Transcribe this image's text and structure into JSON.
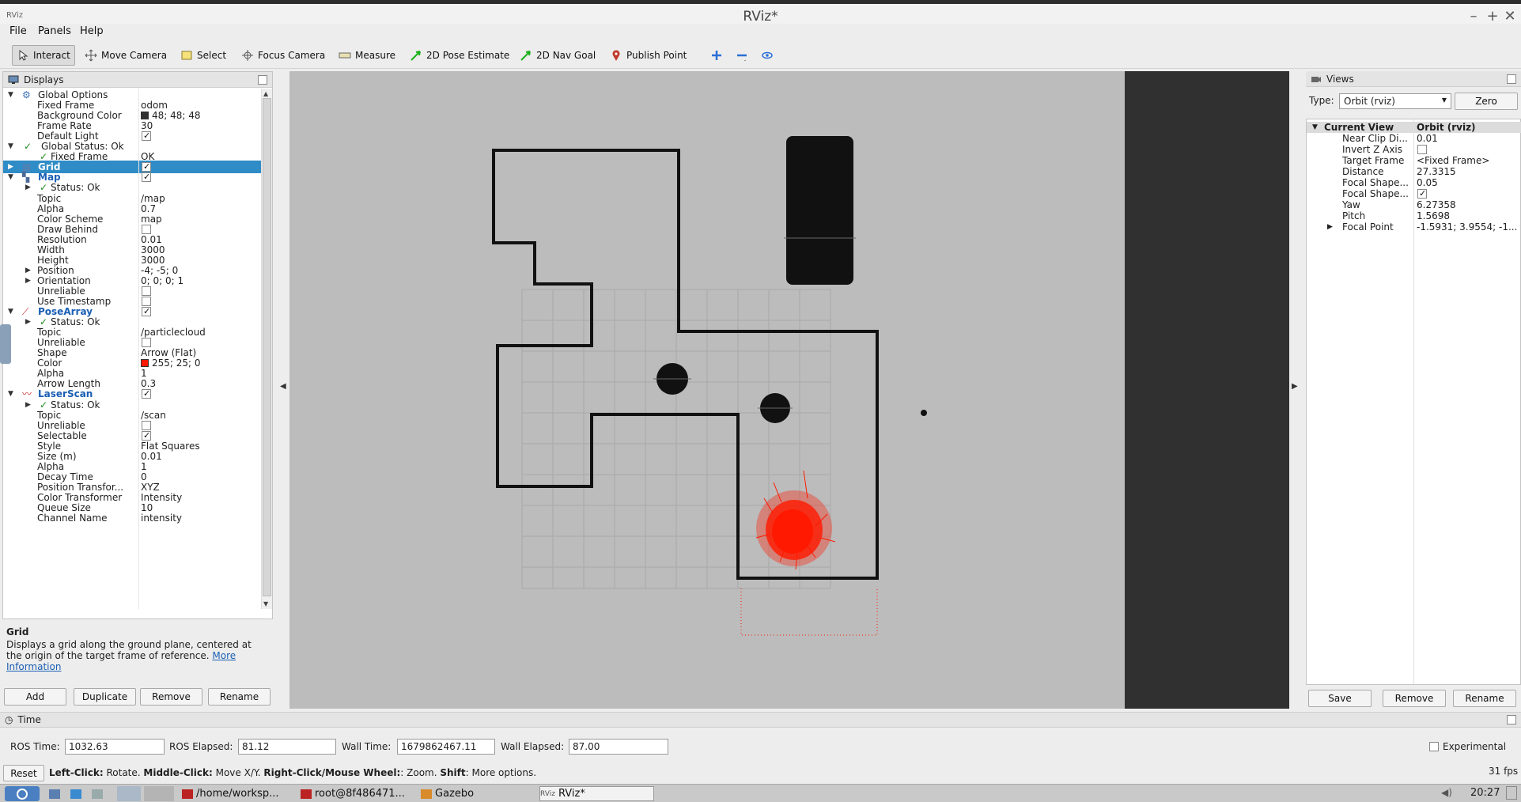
{
  "window": {
    "title": "RViz*",
    "app_icon_text": "RViz"
  },
  "menu": [
    "File",
    "Panels",
    "Help"
  ],
  "toolbar": [
    {
      "label": "Interact",
      "icon": "cursor-icon",
      "active": true
    },
    {
      "label": "Move Camera",
      "icon": "move-camera-icon"
    },
    {
      "label": "Select",
      "icon": "select-box-icon"
    },
    {
      "label": "Focus Camera",
      "icon": "focus-camera-icon"
    },
    {
      "label": "Measure",
      "icon": "ruler-icon"
    },
    {
      "label": "2D Pose Estimate",
      "icon": "green-arrow-icon"
    },
    {
      "label": "2D Nav Goal",
      "icon": "green-arrow-icon"
    },
    {
      "label": "Publish Point",
      "icon": "map-pin-icon"
    }
  ],
  "displays": {
    "header": "Displays",
    "rows": [
      {
        "name": "Global Options",
        "value": "",
        "indent": 0,
        "expand": "open",
        "icon": "gear-icon"
      },
      {
        "name": "Fixed Frame",
        "value": "odom",
        "indent": 1
      },
      {
        "name": "Background Color",
        "value": "48; 48; 48",
        "indent": 1,
        "swatch": "#303030"
      },
      {
        "name": "Frame Rate",
        "value": "30",
        "indent": 1
      },
      {
        "name": "Default Light",
        "value": "",
        "indent": 1,
        "check": true
      },
      {
        "name": "Global Status: Ok",
        "value": "",
        "indent": 0,
        "expand": "open",
        "ok": true
      },
      {
        "name": "Fixed Frame",
        "value": "OK",
        "indent": 1,
        "ok": true
      },
      {
        "name": "Grid",
        "value": "",
        "indent": 0,
        "expand": "closed",
        "check": true,
        "selected": true,
        "blue": true,
        "icon": "grid-icon"
      },
      {
        "name": "Map",
        "value": "",
        "indent": 0,
        "expand": "open",
        "check": true,
        "blue": true,
        "icon": "map-icon"
      },
      {
        "name": "Status: Ok",
        "value": "",
        "indent": 1,
        "expand": "closed",
        "ok": true
      },
      {
        "name": "Topic",
        "value": "/map",
        "indent": 1
      },
      {
        "name": "Alpha",
        "value": "0.7",
        "indent": 1
      },
      {
        "name": "Color Scheme",
        "value": "map",
        "indent": 1
      },
      {
        "name": "Draw Behind",
        "value": "",
        "indent": 1,
        "check": false
      },
      {
        "name": "Resolution",
        "value": "0.01",
        "indent": 1
      },
      {
        "name": "Width",
        "value": "3000",
        "indent": 1
      },
      {
        "name": "Height",
        "value": "3000",
        "indent": 1
      },
      {
        "name": "Position",
        "value": "-4; -5; 0",
        "indent": 1,
        "expand": "closed"
      },
      {
        "name": "Orientation",
        "value": "0; 0; 0; 1",
        "indent": 1,
        "expand": "closed"
      },
      {
        "name": "Unreliable",
        "value": "",
        "indent": 1,
        "check": false
      },
      {
        "name": "Use Timestamp",
        "value": "",
        "indent": 1,
        "check": false
      },
      {
        "name": "PoseArray",
        "value": "",
        "indent": 0,
        "expand": "open",
        "check": true,
        "blue": true,
        "icon": "posearray-icon"
      },
      {
        "name": "Status: Ok",
        "value": "",
        "indent": 1,
        "expand": "closed",
        "ok": true
      },
      {
        "name": "Topic",
        "value": "/particlecloud",
        "indent": 1
      },
      {
        "name": "Unreliable",
        "value": "",
        "indent": 1,
        "check": false
      },
      {
        "name": "Shape",
        "value": "Arrow (Flat)",
        "indent": 1
      },
      {
        "name": "Color",
        "value": "255; 25; 0",
        "indent": 1,
        "swatch": "#ff1900"
      },
      {
        "name": "Alpha",
        "value": "1",
        "indent": 1
      },
      {
        "name": "Arrow Length",
        "value": "0.3",
        "indent": 1
      },
      {
        "name": "LaserScan",
        "value": "",
        "indent": 0,
        "expand": "open",
        "check": true,
        "blue": true,
        "icon": "laserscan-icon"
      },
      {
        "name": "Status: Ok",
        "value": "",
        "indent": 1,
        "expand": "closed",
        "ok": true
      },
      {
        "name": "Topic",
        "value": "/scan",
        "indent": 1
      },
      {
        "name": "Unreliable",
        "value": "",
        "indent": 1,
        "check": false
      },
      {
        "name": "Selectable",
        "value": "",
        "indent": 1,
        "check": true
      },
      {
        "name": "Style",
        "value": "Flat Squares",
        "indent": 1
      },
      {
        "name": "Size (m)",
        "value": "0.01",
        "indent": 1
      },
      {
        "name": "Alpha",
        "value": "1",
        "indent": 1
      },
      {
        "name": "Decay Time",
        "value": "0",
        "indent": 1
      },
      {
        "name": "Position Transfor...",
        "value": "XYZ",
        "indent": 1
      },
      {
        "name": "Color Transformer",
        "value": "Intensity",
        "indent": 1
      },
      {
        "name": "Queue Size",
        "value": "10",
        "indent": 1
      },
      {
        "name": "Channel Name",
        "value": "intensity",
        "indent": 1
      }
    ],
    "description": {
      "title": "Grid",
      "text": "Displays a grid along the ground plane, centered at the origin of the target frame of reference.",
      "link": "More Information"
    },
    "buttons": [
      "Add",
      "Duplicate",
      "Remove",
      "Rename"
    ]
  },
  "views": {
    "header": "Views",
    "type_label": "Type:",
    "type_value": "Orbit (rviz)",
    "zero_label": "Zero",
    "rows": [
      {
        "name": "Current View",
        "value": "Orbit (rviz)",
        "header": true
      },
      {
        "name": "Near Clip Di...",
        "value": "0.01"
      },
      {
        "name": "Invert Z Axis",
        "value": "",
        "check": false
      },
      {
        "name": "Target Frame",
        "value": "<Fixed Frame>"
      },
      {
        "name": "Distance",
        "value": "27.3315"
      },
      {
        "name": "Focal Shape...",
        "value": "0.05"
      },
      {
        "name": "Focal Shape...",
        "value": "",
        "check": true
      },
      {
        "name": "Yaw",
        "value": "6.27358"
      },
      {
        "name": "Pitch",
        "value": "1.5698"
      },
      {
        "name": "Focal Point",
        "value": "-1.5931; 3.9554; -1...",
        "expand": "closed"
      }
    ],
    "buttons": [
      "Save",
      "Remove",
      "Rename"
    ]
  },
  "time": {
    "header": "Time",
    "ros_time_label": "ROS Time:",
    "ros_time": "1032.63",
    "ros_elapsed_label": "ROS Elapsed:",
    "ros_elapsed": "81.12",
    "wall_time_label": "Wall Time:",
    "wall_time": "1679862467.11",
    "wall_elapsed_label": "Wall Elapsed:",
    "wall_elapsed": "87.00",
    "experimental_label": "Experimental"
  },
  "status": {
    "reset_label": "Reset",
    "hint_parts": [
      {
        "b": "Left-Click:",
        "t": " Rotate. "
      },
      {
        "b": "Middle-Click:",
        "t": " Move X/Y. "
      },
      {
        "b": "Right-Click/Mouse Wheel:",
        "t": ": Zoom. "
      },
      {
        "b": "Shift",
        "t": ": More options."
      }
    ],
    "fps": "31 fps"
  },
  "taskbar": {
    "tasks": [
      {
        "label": "/home/worksp...",
        "icon": "terminal-icon"
      },
      {
        "label": "root@8f486471...",
        "icon": "terminal-icon"
      },
      {
        "label": "Gazebo",
        "icon": "gazebo-icon"
      },
      {
        "label": "RViz*",
        "icon": "rviz-icon",
        "active": true
      }
    ],
    "clock": "20:27"
  }
}
